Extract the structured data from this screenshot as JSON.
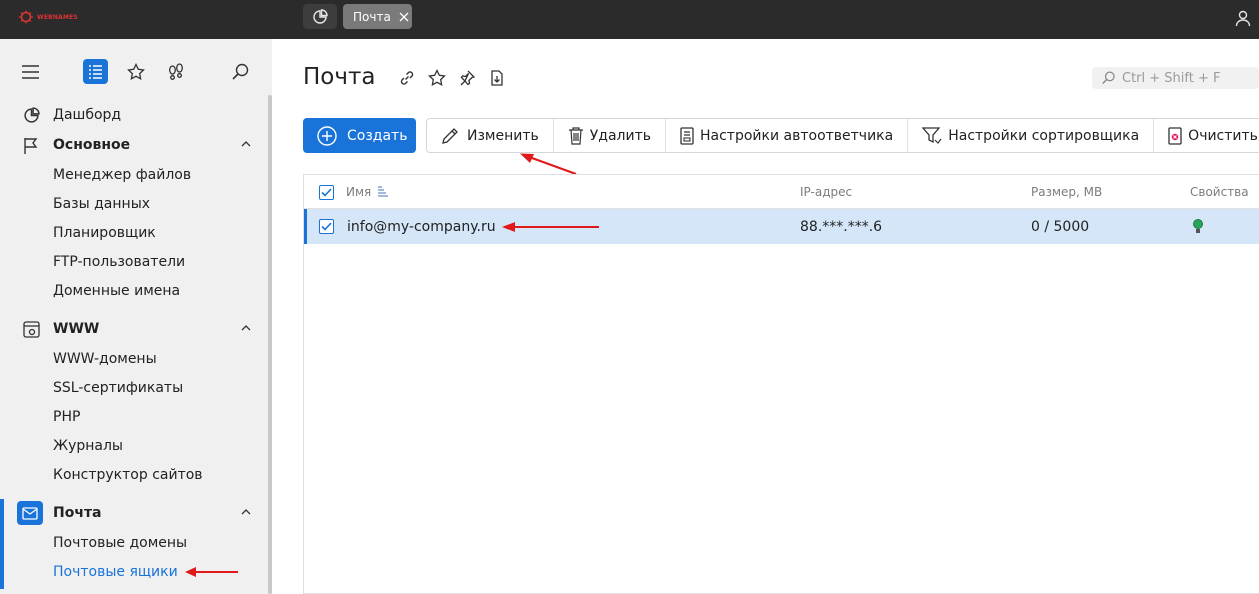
{
  "topbar": {
    "logo_text": "WEBNAMES",
    "active_tab": "Почта"
  },
  "sidebar": {
    "items": [
      {
        "label": "Дашборд",
        "icon": "dashboard-icon"
      },
      {
        "label": "Основное",
        "icon": "flag-icon",
        "section": true
      },
      {
        "label": "Менеджер файлов"
      },
      {
        "label": "Базы данных"
      },
      {
        "label": "Планировщик"
      },
      {
        "label": "FTP-пользователи"
      },
      {
        "label": "Доменные имена"
      },
      {
        "label": "WWW",
        "icon": "www-settings-icon",
        "section": true
      },
      {
        "label": "WWW-домены"
      },
      {
        "label": "SSL-сертификаты"
      },
      {
        "label": "PHP"
      },
      {
        "label": "Журналы"
      },
      {
        "label": "Конструктор сайтов"
      },
      {
        "label": "Почта",
        "icon": "mail-icon",
        "section": true
      },
      {
        "label": "Почтовые домены"
      },
      {
        "label": "Почтовые ящики",
        "current": true
      }
    ]
  },
  "main": {
    "title": "Почта",
    "search_placeholder": "Ctrl + Shift + F",
    "create_label": "Создать",
    "toolbar": [
      {
        "label": "Изменить",
        "icon": "edit-icon"
      },
      {
        "label": "Удалить",
        "icon": "trash-icon"
      },
      {
        "label": "Настройки автоответчика",
        "icon": "autoresponder-icon"
      },
      {
        "label": "Настройки сортировщика",
        "icon": "filter-icon"
      },
      {
        "label": "Очистить",
        "icon": "clear-icon"
      }
    ],
    "more_label": "⋯",
    "table": {
      "columns": {
        "name": "Имя",
        "ip": "IP-адрес",
        "size": "Размер, MB",
        "props": "Свойства"
      },
      "rows": [
        {
          "name": "info@my-company.ru",
          "ip": "88.***.***.6",
          "size": "0 / 5000",
          "status_icon": "lightbulb-icon"
        }
      ]
    }
  },
  "colors": {
    "accent": "#1a73d9",
    "arrow": "#e0191a",
    "topbar": "#2b2b2b",
    "row_selected": "#d5e6f8"
  }
}
